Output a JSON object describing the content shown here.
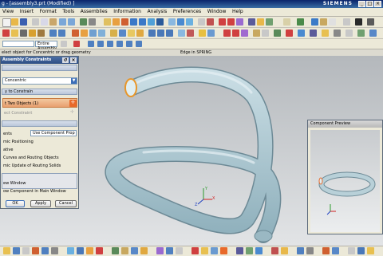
{
  "window": {
    "title": "g - [assembly3.prt (Modified) ]",
    "brand": "SIEMENS",
    "minimize_label": "_",
    "maximize_label": "□",
    "close_label": "×"
  },
  "menubar": {
    "items": [
      "View",
      "Insert",
      "Format",
      "Tools",
      "Assemblies",
      "Information",
      "Analysis",
      "Preferences",
      "Window",
      "Help"
    ]
  },
  "selection_bar": {
    "filter_value": "Entire Assembly"
  },
  "cue_line": {
    "prompt": "elect object for Concentric or drag geometry",
    "status": "Edge in SPRING"
  },
  "dialog": {
    "title": "Assembly Constraints",
    "type_value": "Concentric",
    "geometry_group": "y to Constrain",
    "select_two_objects": "t Two Objects (1)",
    "second_selection": "ect Constraint",
    "settings_label": "ents",
    "positioning_label": "Use Component Prop",
    "opt1": "mic Positioning",
    "opt2": "ative",
    "opt3": "Curves and Routing Objects",
    "opt4": "mic Update of Routing Solids",
    "preview_group": "ew Window",
    "preview_opt": "ow Component in Main Window",
    "ok": "OK",
    "apply": "Apply",
    "cancel": "Cancel"
  },
  "preview": {
    "title": "Component Preview"
  },
  "axis": {
    "x": "X",
    "y": "Y",
    "z": "Z"
  },
  "colors": {
    "title_bar": "#0a246a",
    "spring_body": "#aac3cd",
    "spring_edge": "#6d8a96",
    "highlight": "#e8962a",
    "accent_orange": "#e8692a"
  }
}
